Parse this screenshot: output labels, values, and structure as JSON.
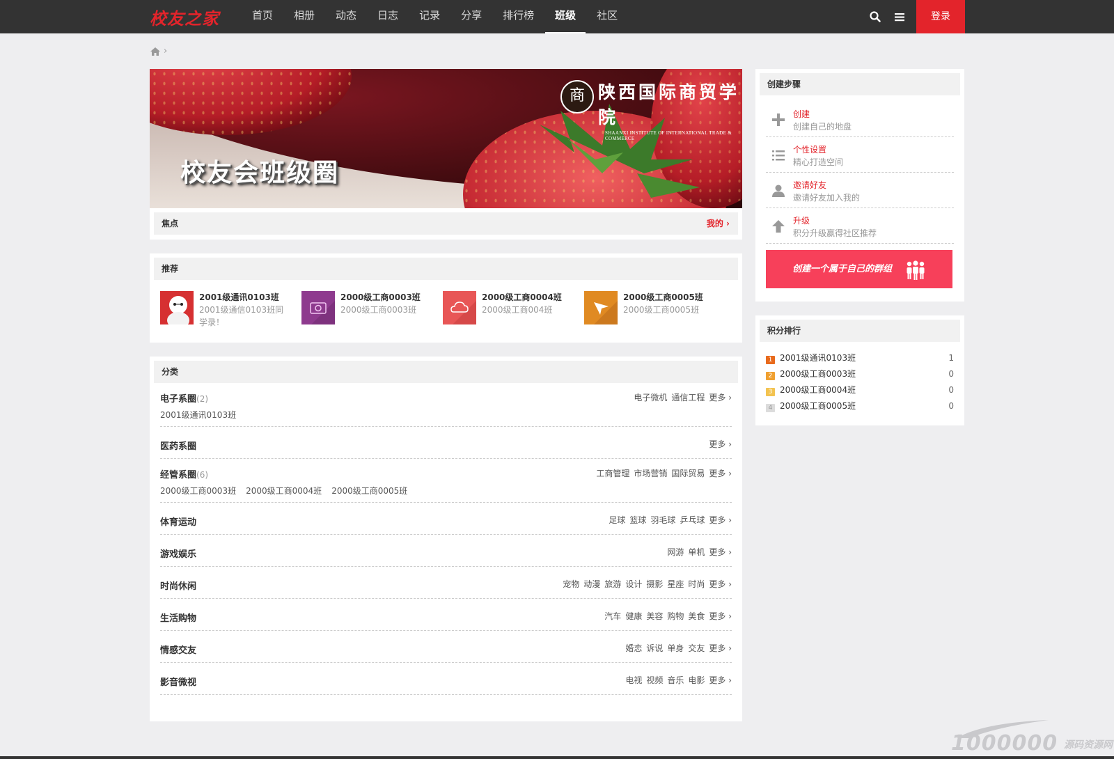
{
  "header": {
    "logo": "校友之家",
    "nav": [
      "首页",
      "相册",
      "动态",
      "日志",
      "记录",
      "分享",
      "排行榜",
      "班级",
      "社区"
    ],
    "active_nav": "班级",
    "login": "登录"
  },
  "breadcrumb": {
    "separator": "›"
  },
  "banner": {
    "text": "校友会班级圈",
    "org_cn": "陕西国际商贸学院",
    "org_en": "SHAANXI INSTITUTE OF INTERNATIONAL TRADE & COMMERCE",
    "seal_char": "商"
  },
  "focus": {
    "title": "焦点",
    "more": "我的 ›"
  },
  "recommend": {
    "title": "推荐",
    "items": [
      {
        "title": "2001级通讯0103班",
        "desc": "2001级通信0103班同学录！",
        "thumb_color": "#d63031",
        "icon": "avatar-robot-icon"
      },
      {
        "title": "2000级工商0003班",
        "desc": "2000级工商0003班",
        "thumb_color": "#8e3a8e",
        "icon": "camera-icon"
      },
      {
        "title": "2000级工商0004班",
        "desc": "2000级工商004班",
        "thumb_color": "#e85656",
        "icon": "cloud-icon"
      },
      {
        "title": "2000级工商0005班",
        "desc": "2000级工商0005班",
        "thumb_color": "#e08a22",
        "icon": "send-icon"
      }
    ]
  },
  "category": {
    "title": "分类",
    "more": "更多 ›",
    "rows": [
      {
        "name": "电子系圈",
        "count": "(2)",
        "tags": [
          "电子微机",
          "通信工程"
        ],
        "groups": [
          "2001级通讯0103班"
        ]
      },
      {
        "name": "医药系圈",
        "count": "",
        "tags": [],
        "groups": []
      },
      {
        "name": "经管系圈",
        "count": "(6)",
        "tags": [
          "工商管理",
          "市场营销",
          "国际贸易"
        ],
        "groups": [
          "2000级工商0003班",
          "2000级工商0004班",
          "2000级工商0005班"
        ]
      },
      {
        "name": "体育运动",
        "count": "",
        "tags": [
          "足球",
          "篮球",
          "羽毛球",
          "乒乓球"
        ],
        "groups": []
      },
      {
        "name": "游戏娱乐",
        "count": "",
        "tags": [
          "网游",
          "单机"
        ],
        "groups": []
      },
      {
        "name": "时尚休闲",
        "count": "",
        "tags": [
          "宠物",
          "动漫",
          "旅游",
          "设计",
          "摄影",
          "星座",
          "时尚"
        ],
        "groups": []
      },
      {
        "name": "生活购物",
        "count": "",
        "tags": [
          "汽车",
          "健康",
          "美容",
          "购物",
          "美食"
        ],
        "groups": []
      },
      {
        "name": "情感交友",
        "count": "",
        "tags": [
          "婚恋",
          "诉说",
          "单身",
          "交友"
        ],
        "groups": []
      },
      {
        "name": "影音微视",
        "count": "",
        "tags": [
          "电视",
          "视频",
          "音乐",
          "电影"
        ],
        "groups": []
      }
    ]
  },
  "steps": {
    "title": "创建步骤",
    "items": [
      {
        "title": "创建",
        "desc": "创建自己的地盘",
        "icon": "plus-icon"
      },
      {
        "title": "个性设置",
        "desc": "精心打造空间",
        "icon": "list-icon"
      },
      {
        "title": "邀请好友",
        "desc": "邀请好友加入我的",
        "icon": "user-icon"
      },
      {
        "title": "升级",
        "desc": "积分升级赢得社区推荐",
        "icon": "arrow-up-icon"
      }
    ],
    "create_button": "创建一个属于自己的群组"
  },
  "rank": {
    "title": "积分排行",
    "items": [
      {
        "num": "1",
        "name": "2001级通讯0103班",
        "score": "1",
        "color": "#e86a1c"
      },
      {
        "num": "2",
        "name": "2000级工商0003班",
        "score": "0",
        "color": "#f0a030"
      },
      {
        "num": "3",
        "name": "2000级工商0004班",
        "score": "0",
        "color": "#f3c350"
      },
      {
        "num": "4",
        "name": "2000级工商0005班",
        "score": "0",
        "color": "#dcdcdc"
      }
    ]
  },
  "watermark": {
    "text": "1000000",
    "sub": "源码资源网"
  },
  "colors": {
    "accent": "#e3242b",
    "topbar": "#333333",
    "create_button": "#f7405a"
  }
}
